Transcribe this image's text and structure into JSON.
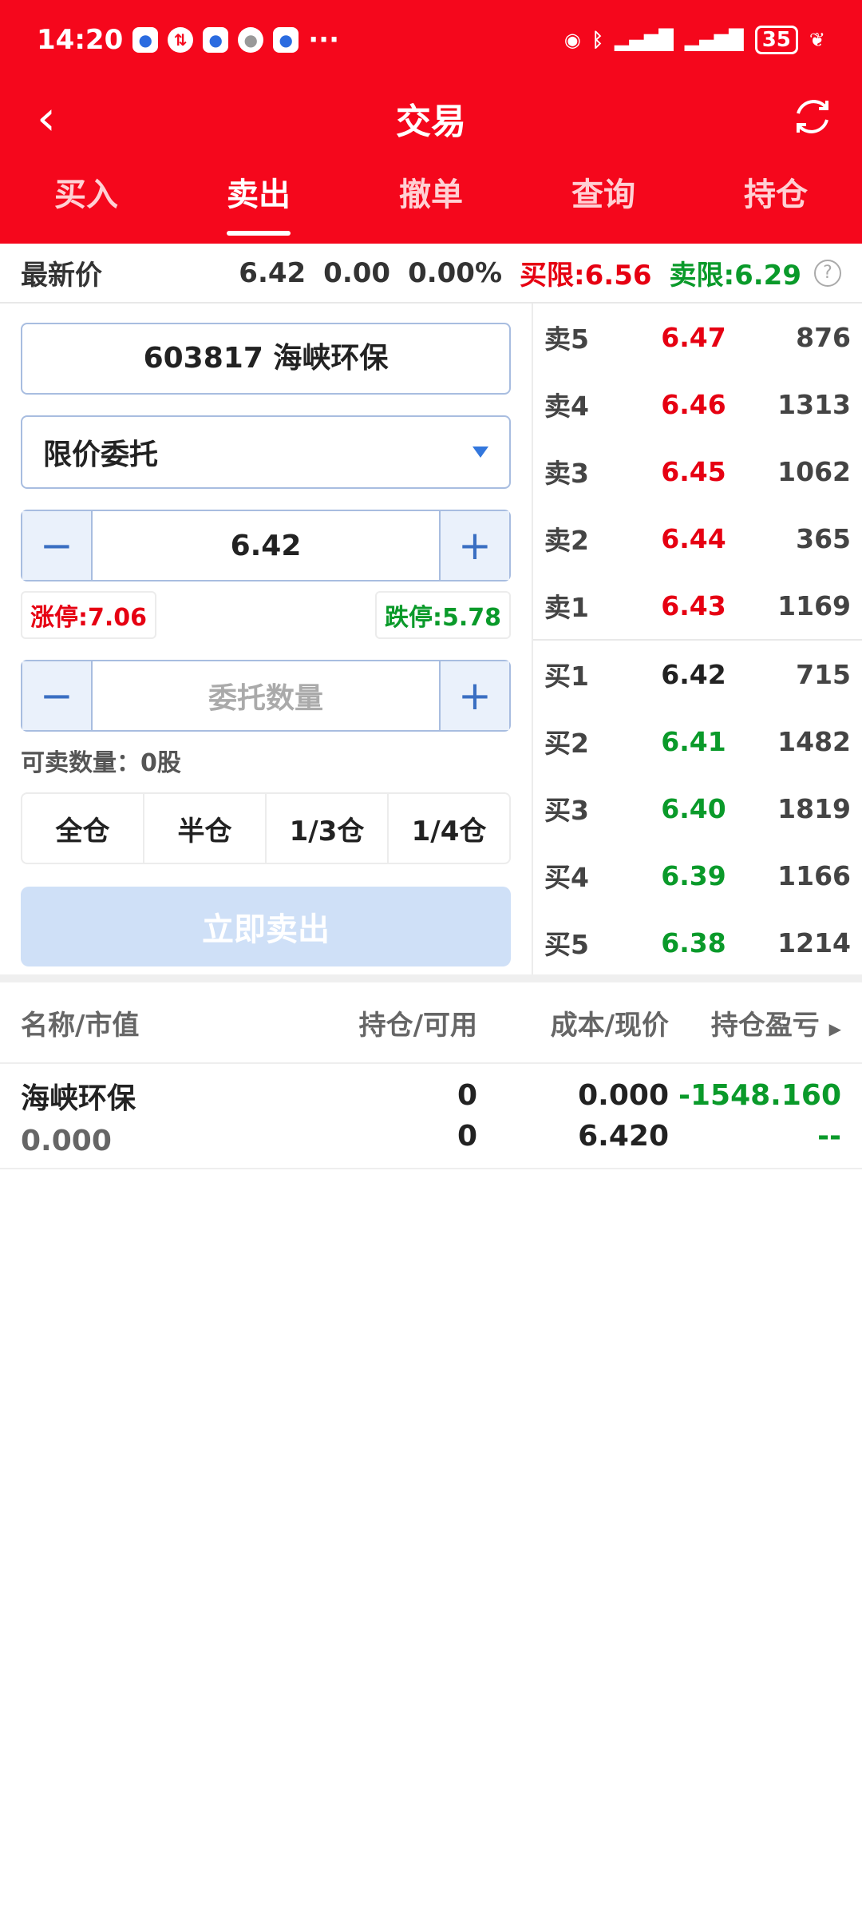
{
  "status": {
    "time": "14:20",
    "battery": "35",
    "dots": "···"
  },
  "header": {
    "title": "交易",
    "back": "‹"
  },
  "tabs": [
    {
      "label": "买入"
    },
    {
      "label": "卖出"
    },
    {
      "label": "撤单"
    },
    {
      "label": "查询"
    },
    {
      "label": "持仓"
    }
  ],
  "pricebar": {
    "label": "最新价",
    "price": "6.42",
    "change": "0.00",
    "pct": "0.00%",
    "buy_limit": "买限:6.56",
    "sell_limit": "卖限:6.29",
    "help": "?"
  },
  "form": {
    "stock": "603817 海峡环保",
    "order_type": "限价委托",
    "price": "6.42",
    "minus": "−",
    "plus": "+",
    "limit_up": "涨停:7.06",
    "limit_down": "跌停:5.78",
    "qty_placeholder": "委托数量",
    "available": "可卖数量：0股",
    "ratios": [
      "全仓",
      "半仓",
      "1/3仓",
      "1/4仓"
    ],
    "submit": "立即卖出"
  },
  "orderbook": {
    "asks": [
      {
        "label": "卖5",
        "price": "6.47",
        "vol": "876"
      },
      {
        "label": "卖4",
        "price": "6.46",
        "vol": "1313"
      },
      {
        "label": "卖3",
        "price": "6.45",
        "vol": "1062"
      },
      {
        "label": "卖2",
        "price": "6.44",
        "vol": "365"
      },
      {
        "label": "卖1",
        "price": "6.43",
        "vol": "1169"
      }
    ],
    "bids": [
      {
        "label": "买1",
        "price": "6.42",
        "vol": "715"
      },
      {
        "label": "买2",
        "price": "6.41",
        "vol": "1482"
      },
      {
        "label": "买3",
        "price": "6.40",
        "vol": "1819"
      },
      {
        "label": "买4",
        "price": "6.39",
        "vol": "1166"
      },
      {
        "label": "买5",
        "price": "6.38",
        "vol": "1214"
      }
    ]
  },
  "holdings": {
    "headers": [
      "名称/市值",
      "持仓/可用",
      "成本/现价",
      "持仓盈亏"
    ],
    "rows": [
      {
        "name": "海峡环保",
        "value": "0.000",
        "hold": "0",
        "avail": "0",
        "cost": "0.000",
        "now": "6.420",
        "pnl": "-1548.160",
        "pnl_pct": "--"
      }
    ]
  },
  "colors": {
    "brand": "#f5071c",
    "up": "#e60012",
    "down": "#0a9a2a",
    "accent": "#3377dd"
  }
}
